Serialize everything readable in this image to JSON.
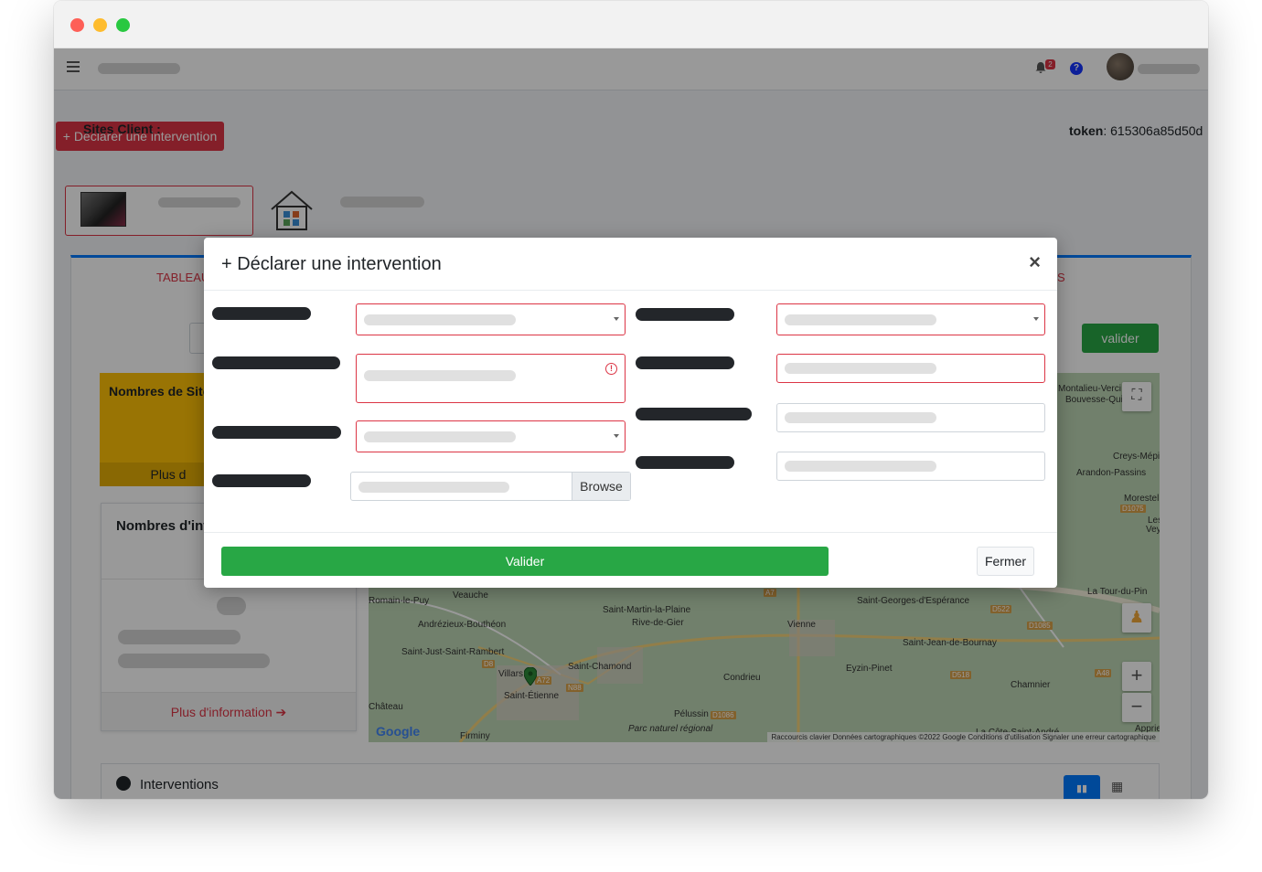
{
  "header": {
    "declare_button": "+ Déclarer une intervention",
    "token_label": "token",
    "token_value": ": 615306a85d50d",
    "notification_count": "2",
    "help_glyph": "?"
  },
  "tabs": {
    "first_label": "TABLEAU",
    "last_label": "S"
  },
  "filters": {
    "sites_label": "Sites Client :",
    "valider_label": "valider"
  },
  "cards": {
    "sites_title": "Nombres de Sites",
    "sites_footer": "Plus d",
    "interventions_title": "Nombres d'int",
    "more_info": "Plus d'information"
  },
  "map": {
    "labels": [
      "Montalieu-Verci",
      "Bouvesse-Qui",
      "Creys-Mépi",
      "Arandon-Passins",
      "Morestel",
      "Les",
      "Vey",
      "La Tour-du-Pin",
      "Romain-le-Puy",
      "Veauche",
      "Saint-Martin-la-Plaine",
      "Andrézieux-Bouthéon",
      "Rive-de-Gier",
      "Vienne",
      "Saint-Georges-d'Espérance",
      "Saint-Just-Saint-Rambert",
      "Saint-Chamond",
      "Saint-Jean-de-Bournay",
      "Villars",
      "Condrieu",
      "Eyzin-Pinet",
      "Saint-Étienne",
      "Château",
      "Pélussin",
      "Chamnier",
      "Firminy",
      "Parc naturel régional",
      "Apprie",
      "La Côte-Saint-André"
    ],
    "roads": [
      "D1075",
      "A7",
      "D522",
      "D1085",
      "D8",
      "A72",
      "N88",
      "D518",
      "A48",
      "D1086"
    ],
    "attribution": "Raccourcis clavier   Données cartographiques ©2022 Google   Conditions d'utilisation   Signaler une erreur cartographique",
    "google": "Google"
  },
  "interventions": {
    "title": "Interventions"
  },
  "modal": {
    "title": "+ Déclarer une intervention",
    "close": "×",
    "browse_label": "Browse",
    "submit_label": "Valider",
    "close_label": "Fermer"
  },
  "colors": {
    "danger": "#dc3545",
    "success": "#28a745",
    "primary": "#007bff",
    "warning": "#ffc107"
  }
}
